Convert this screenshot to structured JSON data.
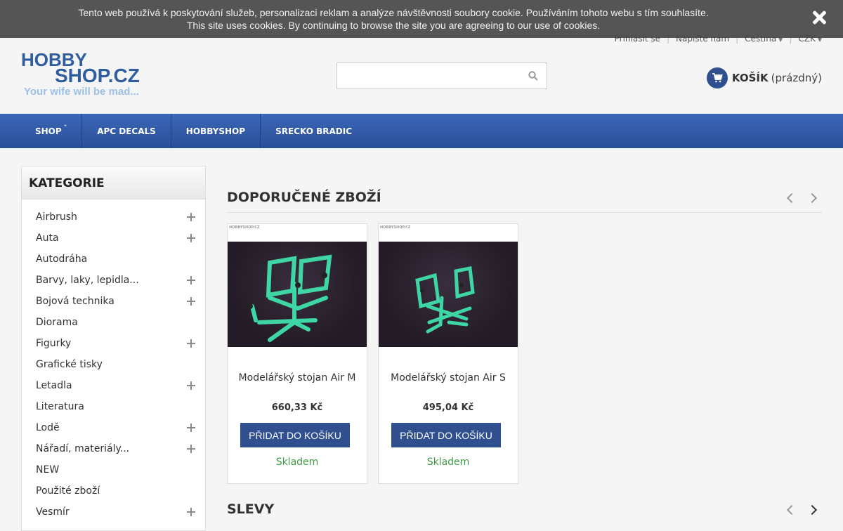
{
  "cookie": {
    "line1": "Tento web používá k poskytování služeb, personalizaci reklam a analýze návštěvnosti soubory cookie. Používáním tohoto webu s tím souhlasíte.",
    "line2": "This site uses cookies. By continuing to browse the site you are agreeing to our use of cookies."
  },
  "toplinks": {
    "login": "Přihlásit se",
    "contact": "Napište nám",
    "language": "Čeština",
    "currency": "CZK"
  },
  "logo": {
    "word1": "HOBBY",
    "word2": "SHOP.CZ",
    "tagline": "Your wife will be mad..."
  },
  "search": {
    "placeholder": ""
  },
  "cart": {
    "label": "KOŠÍK",
    "status": "(prázdný)"
  },
  "nav": {
    "items": [
      "SHOP",
      "APC DECALS",
      "HOBBYSHOP",
      "SRECKO BRADIC"
    ]
  },
  "sidebar": {
    "title": "KATEGORIE",
    "items": [
      {
        "label": "Airbrush",
        "expandable": true
      },
      {
        "label": "Auta",
        "expandable": true
      },
      {
        "label": "Autodráha",
        "expandable": false
      },
      {
        "label": "Barvy, laky, lepidla...",
        "expandable": true
      },
      {
        "label": "Bojová technika",
        "expandable": true
      },
      {
        "label": "Diorama",
        "expandable": false
      },
      {
        "label": "Figurky",
        "expandable": true
      },
      {
        "label": "Grafické tisky",
        "expandable": false
      },
      {
        "label": "Letadla",
        "expandable": true
      },
      {
        "label": "Literatura",
        "expandable": false
      },
      {
        "label": "Lodě",
        "expandable": true
      },
      {
        "label": "Nářadí, materiály...",
        "expandable": true
      },
      {
        "label": "NEW",
        "expandable": false
      },
      {
        "label": "Použité zboží",
        "expandable": false
      },
      {
        "label": "Vesmír",
        "expandable": true
      }
    ]
  },
  "sections": {
    "featured": "DOPORUČENÉ ZBOŽÍ",
    "sale": "SLEVY"
  },
  "products": [
    {
      "watermark": "HOBBYSHOP.CZ",
      "name": "Modelářský stojan Air M",
      "price": "660,33 Kč",
      "button": "PŘIDAT DO KOŠÍKU",
      "stock": "Skladem"
    },
    {
      "watermark": "HOBBYSHOP.CZ",
      "name": "Modelářský stojan Air S",
      "price": "495,04 Kč",
      "button": "PŘIDAT DO KOŠÍKU",
      "stock": "Skladem"
    }
  ],
  "colors": {
    "nav": "#2f5aa8",
    "button": "#2f4f8f",
    "stock": "#3f9a45",
    "logo": "#2f5d9e"
  }
}
